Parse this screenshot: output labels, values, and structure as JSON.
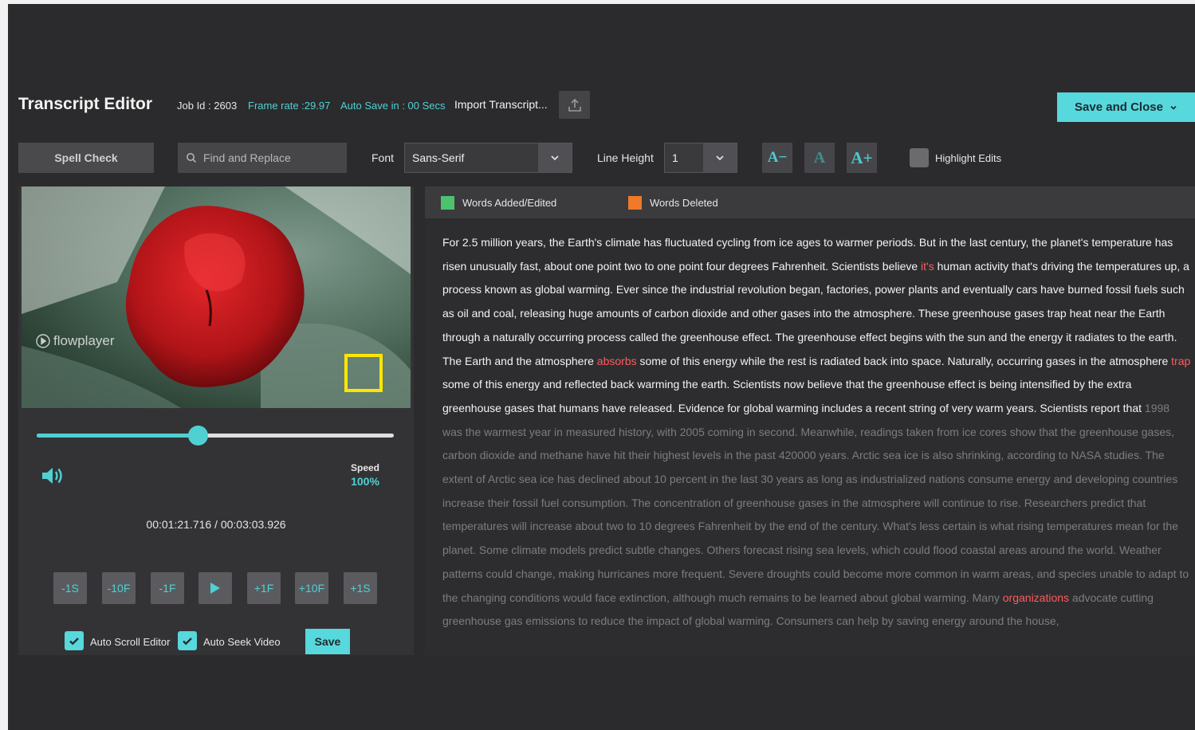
{
  "header": {
    "title": "Transcript Editor",
    "job_id": "Job Id : 2603",
    "frame_rate": "Frame rate :29.97",
    "auto_save": "Auto Save in : 00 Secs",
    "import_label": "Import Transcript...",
    "save_close_label": "Save and Close"
  },
  "toolbar": {
    "spell_check": "Spell Check",
    "find_placeholder": "Find and Replace",
    "font_label": "Font",
    "font_value": "Sans-Serif",
    "line_height_label": "Line Height",
    "line_height_value": "1",
    "font_decrease": "A−",
    "font_reset": "A",
    "font_increase": "A+",
    "highlight_edits": "Highlight Edits"
  },
  "player": {
    "watermark": "flowplayer",
    "seek_fraction": 0.45,
    "speed_label": "Speed",
    "speed_value": "100%",
    "timecode": "00:01:21.716 / 00:03:03.926",
    "controls": [
      "-1S",
      "-10F",
      "-1F",
      "play",
      "+1F",
      "+10F",
      "+1S"
    ],
    "auto_scroll_label": "Auto Scroll Editor",
    "auto_seek_label": "Auto Seek Video",
    "save_label": "Save"
  },
  "legend": {
    "added": "Words Added/Edited",
    "deleted": "Words Deleted"
  },
  "colors": {
    "accent": "#4fd1d3",
    "added": "#4cc26e",
    "deleted": "#f0792a",
    "edited_word": "#ff5a5f"
  },
  "transcript": {
    "p1": "For 2.5 million years, the Earth's climate has fluctuated cycling from ice ages to warmer periods. But in the last century, the planet's temperature has risen unusually fast, about one point two to one point four degrees Fahrenheit. Scientists believe ",
    "w1": "it's",
    "p2": " human activity that's driving the temperatures up, a process known as global warming. Ever since the industrial revolution began, factories, power plants and eventually cars have burned fossil fuels such as oil and coal, releasing huge amounts of carbon dioxide and other gases into the atmosphere. These greenhouse gases trap heat near the Earth through a naturally occurring process called the greenhouse effect. The greenhouse effect begins with the sun and the energy it radiates to the earth. The Earth and the atmosphere ",
    "w2": "absorbs",
    "p3": " some of this energy while the rest is radiated back into space. Naturally, occurring gases in the atmosphere ",
    "w3": "trap",
    "p4": " some of this energy and reflected back warming the earth. Scientists now believe that the greenhouse effect is being intensified by the extra greenhouse gases that humans have released. Evidence for global warming includes a recent string of very warm years. Scientists report that ",
    "d1": "1998 was the warmest year in measured history, with 2005 coming in second. Meanwhile, readings taken from ice cores show that the greenhouse gases, carbon dioxide and methane have hit their highest levels in the past 420000 years. Arctic sea ice is also shrinking, according to NASA studies. The extent of Arctic sea ice has declined about 10 percent in the last 30 years as long as industrialized nations consume energy and developing countries increase their fossil fuel consumption. The concentration of greenhouse gases in the atmosphere will continue to rise. Researchers predict that temperatures will increase about two to 10 degrees Fahrenheit by the end of the century. What's less certain is what rising temperatures mean for the planet. Some climate models predict subtle changes. Others forecast rising sea levels, which could flood coastal areas around the world. Weather patterns could change, making hurricanes more frequent. Severe droughts could become more common in warm areas, and species unable to adapt to the changing conditions would face extinction, although much remains to be learned about global warming. Many ",
    "w4": "organizations",
    "d2": " advocate cutting greenhouse gas emissions to reduce the impact of global warming. Consumers can help by saving energy around the house,"
  }
}
